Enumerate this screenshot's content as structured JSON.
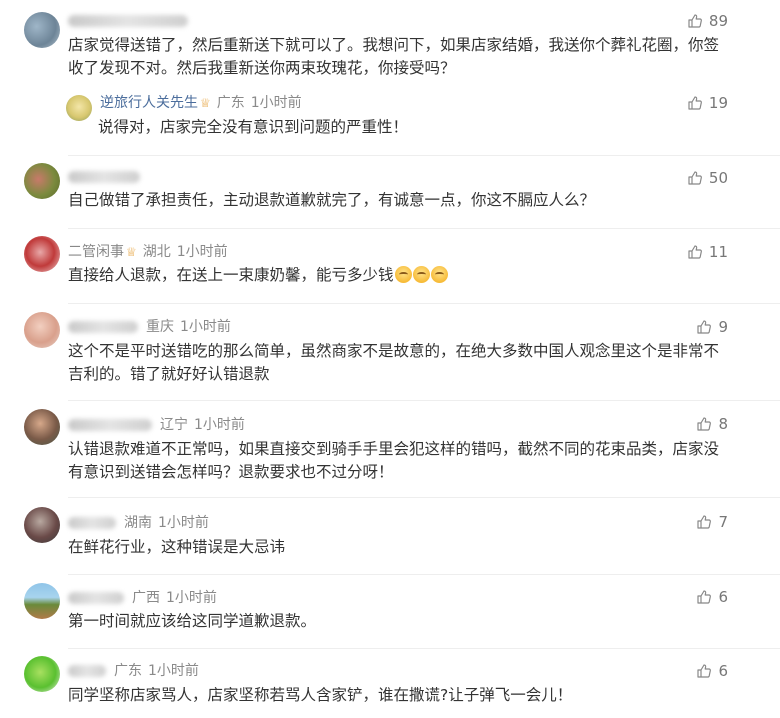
{
  "comments": [
    {
      "name": "",
      "location": "",
      "time": "",
      "likes": "89",
      "text": "店家觉得送错了，然后重新送下就可以了。我想问下，如果店家结婚，我送你个葬礼花圈，你签收了发现不对。然后我重新送你两束玫瑰花，你接受吗？",
      "reply": {
        "name": "逆旅行人关先生",
        "location": "广东",
        "time": "1小时前",
        "likes": "19",
        "text": "说得对，店家完全没有意识到问题的严重性！"
      }
    },
    {
      "name": "",
      "location": "",
      "time": "",
      "likes": "50",
      "text": "自己做错了承担责任，主动退款道歉就完了，有诚意一点，你这不膈应人么？"
    },
    {
      "name": "二管闲事",
      "location": "湖北",
      "time": "1小时前",
      "likes": "11",
      "text": "直接给人退款，在送上一束康奶馨，能亏多少钱"
    },
    {
      "name": "",
      "location": "重庆",
      "time": "1小时前",
      "likes": "9",
      "text": "这个不是平时送错吃的那么简单，虽然商家不是故意的，在绝大多数中国人观念里这个是非常不吉利的。错了就好好认错退款"
    },
    {
      "name": "",
      "location": "辽宁",
      "time": "1小时前",
      "likes": "8",
      "text": "认错退款难道不正常吗，如果直接交到骑手手里会犯这样的错吗，截然不同的花束品类，店家没有意识到送错会怎样吗？退款要求也不过分呀！"
    },
    {
      "name": "",
      "location": "湖南",
      "time": "1小时前",
      "likes": "7",
      "text": "在鲜花行业，这种错误是大忌讳"
    },
    {
      "name": "",
      "location": "广西",
      "time": "1小时前",
      "likes": "6",
      "text": "第一时间就应该给这同学道歉退款。"
    },
    {
      "name": "",
      "location": "广东",
      "time": "1小时前",
      "likes": "6",
      "text": "同学坚称店家骂人，店家坚称若骂人含家铲，谁在撒谎?让子弹飞一会儿！"
    }
  ],
  "icons": {
    "like": "thumbs-up-icon",
    "badge": "crown-badge-icon",
    "emoji": "grin-sweat-emoji"
  }
}
